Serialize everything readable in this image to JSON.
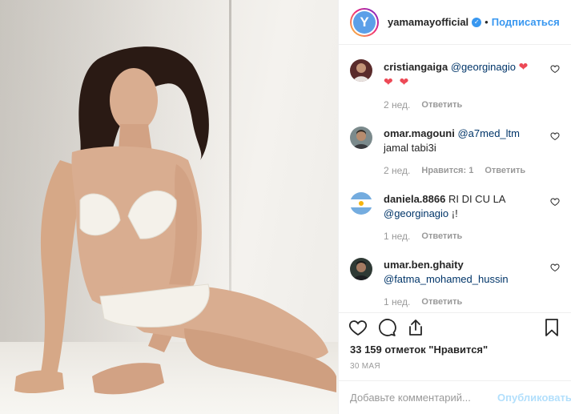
{
  "post": {
    "username": "yamamayofficial",
    "avatar_letter": "Y",
    "verified_icon": "verified-badge-icon",
    "separator": "•",
    "follow_label": "Подписаться"
  },
  "comments": [
    {
      "user": "cristiangaiga",
      "mention": "@georginagio",
      "text": "",
      "hearts": "❤ ❤ ❤",
      "time": "2 нед.",
      "likes": "",
      "reply": "Ответить"
    },
    {
      "user": "omar.magouni",
      "mention": "@a7med_ltm",
      "text": "jamal tabi3i",
      "time": "2 нед.",
      "likes": "Нравится: 1",
      "reply": "Ответить"
    },
    {
      "user": "daniela.8866",
      "text_before": "RI DI CU LA",
      "mention": "@georginagio",
      "text": "¡!",
      "time": "1 нед.",
      "likes": "",
      "reply": "Ответить"
    },
    {
      "user": "umar.ben.ghaity",
      "mention": "@fatma_mohamed_hussin",
      "text": "",
      "time": "1 нед.",
      "likes": "",
      "reply": "Ответить"
    }
  ],
  "actions": {
    "like_icon": "heart-icon",
    "comment_icon": "comment-icon",
    "share_icon": "share-icon",
    "save_icon": "bookmark-icon"
  },
  "likes_text": "33 159 отметок \"Нравится\"",
  "date": "30 МАЯ",
  "add_comment": {
    "placeholder": "Добавьте комментарий...",
    "publish_label": "Опубликовать"
  },
  "colors": {
    "link": "#3897f0",
    "mention": "#003569",
    "heart_red": "#ed4956",
    "muted": "#999999",
    "publish_disabled": "#b2dffc"
  }
}
